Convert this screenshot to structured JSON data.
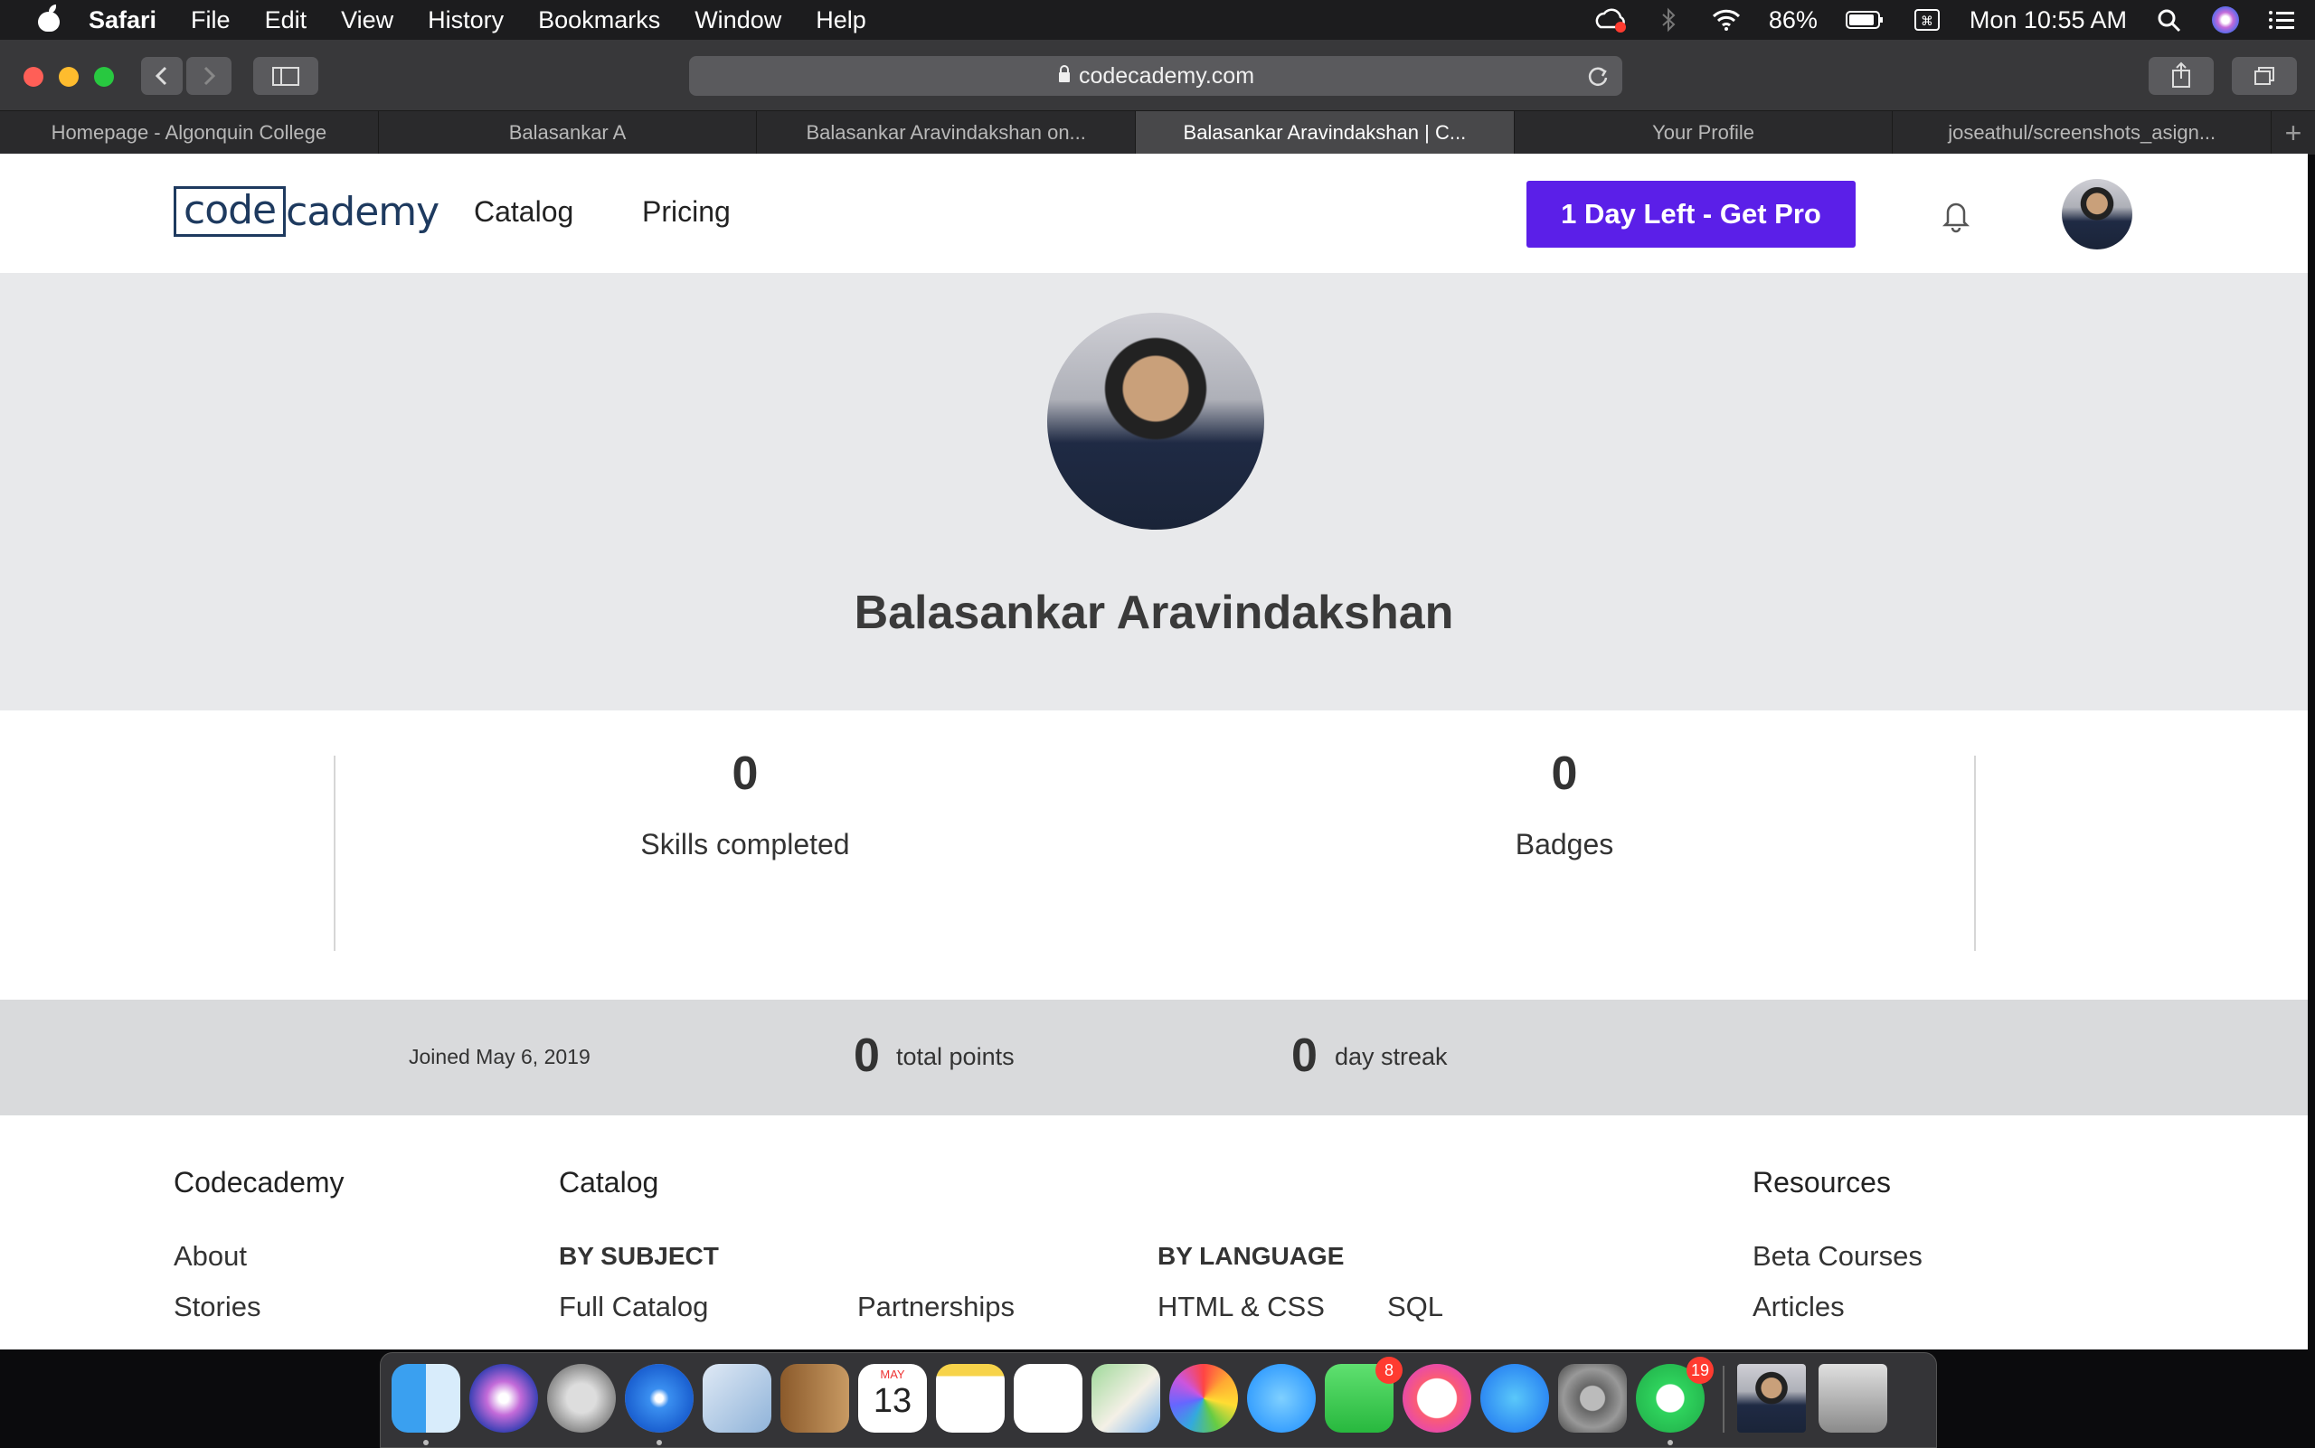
{
  "menubar": {
    "app": "Safari",
    "items": [
      "File",
      "Edit",
      "View",
      "History",
      "Bookmarks",
      "Window",
      "Help"
    ],
    "battery": "86%",
    "clock": "Mon 10:55 AM"
  },
  "browser": {
    "url": "codecademy.com",
    "tabs": [
      {
        "label": "Homepage - Algonquin College"
      },
      {
        "label": "Balasankar A"
      },
      {
        "label": "Balasankar Aravindakshan on..."
      },
      {
        "label": "Balasankar Aravindakshan | C..."
      },
      {
        "label": "Your Profile"
      },
      {
        "label": "joseathul/screenshots_asign..."
      }
    ],
    "active_tab": 3
  },
  "site_nav": {
    "logo_left": "code",
    "logo_right": "cademy",
    "links": [
      "Catalog",
      "Pricing"
    ],
    "pro_button": "1 Day Left - Get Pro",
    "brand_color": "#5b1fe8"
  },
  "profile": {
    "name": "Balasankar Aravindakshan",
    "skills_completed": "0",
    "skills_label": "Skills completed",
    "badges": "0",
    "badges_label": "Badges",
    "joined": "Joined May 6, 2019",
    "total_points": "0",
    "total_points_label": "total points",
    "day_streak": "0",
    "day_streak_label": "day streak"
  },
  "footer": {
    "col1_title": "Codecademy",
    "col1_links": [
      "About",
      "Stories"
    ],
    "col2_title": "Catalog",
    "by_subject": "BY SUBJECT",
    "full_catalog": "Full Catalog",
    "partnerships": "Partnerships",
    "by_language": "BY LANGUAGE",
    "html_css": "HTML & CSS",
    "sql": "SQL",
    "col4_title": "Resources",
    "col4_links": [
      "Beta Courses",
      "Articles"
    ]
  },
  "dock": {
    "facetime_badge": "8",
    "whatsapp_badge": "19",
    "calendar_month": "MAY",
    "calendar_day": "13"
  }
}
